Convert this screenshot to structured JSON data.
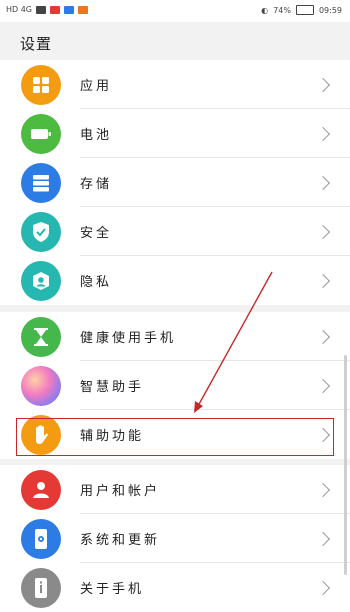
{
  "status_bar": {
    "left_text": "HD 4G",
    "battery": "74%",
    "time": "09:59"
  },
  "page_title": "设置",
  "sections": [
    {
      "items": [
        {
          "label": "应用",
          "icon": "apps-icon",
          "color": "#f39c12"
        },
        {
          "label": "电池",
          "icon": "battery-icon",
          "color": "#4cbb3f"
        },
        {
          "label": "存储",
          "icon": "storage-icon",
          "color": "#2d7be5"
        },
        {
          "label": "安全",
          "icon": "shield-check-icon",
          "color": "#26b8b0"
        },
        {
          "label": "隐私",
          "icon": "privacy-icon",
          "color": "#26b8b0"
        }
      ]
    },
    {
      "items": [
        {
          "label": "健康使用手机",
          "icon": "hourglass-icon",
          "color": "#44b84a"
        },
        {
          "label": "智慧助手",
          "icon": "assistant-icon",
          "color": "#b37cf0"
        },
        {
          "label": "辅助功能",
          "icon": "hand-icon",
          "color": "#f39c12"
        }
      ]
    },
    {
      "items": [
        {
          "label": "用户和帐户",
          "icon": "user-icon",
          "color": "#e53935"
        },
        {
          "label": "系统和更新",
          "icon": "system-update-icon",
          "color": "#2d7be5"
        },
        {
          "label": "关于手机",
          "icon": "info-icon",
          "color": "#8a8a8a"
        }
      ]
    }
  ]
}
